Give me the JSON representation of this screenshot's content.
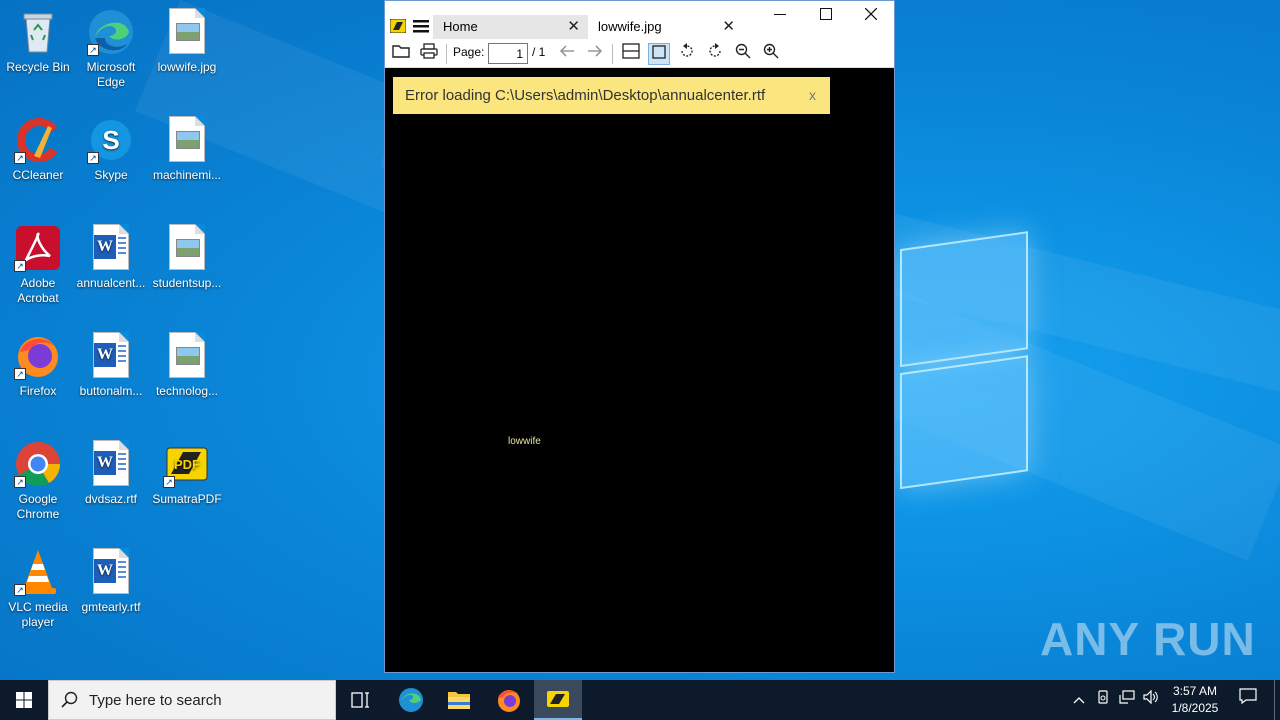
{
  "desktop": {
    "icons": [
      {
        "label": "Recycle Bin",
        "icon": "recycle-bin-icon"
      },
      {
        "label": "Microsoft Edge",
        "icon": "edge-icon"
      },
      {
        "label": "lowwife.jpg",
        "icon": "image-file-icon"
      },
      {
        "label": "CCleaner",
        "icon": "ccleaner-icon"
      },
      {
        "label": "Skype",
        "icon": "skype-icon"
      },
      {
        "label": "machinemi...",
        "icon": "image-file-icon"
      },
      {
        "label": "Adobe Acrobat",
        "icon": "acrobat-icon"
      },
      {
        "label": "annualcent...",
        "icon": "word-file-icon"
      },
      {
        "label": "studentsup...",
        "icon": "image-file-icon"
      },
      {
        "label": "Firefox",
        "icon": "firefox-icon"
      },
      {
        "label": "buttonalm...",
        "icon": "word-file-icon"
      },
      {
        "label": "technolog...",
        "icon": "image-file-icon"
      },
      {
        "label": "Google Chrome",
        "icon": "chrome-icon"
      },
      {
        "label": "dvdsaz.rtf",
        "icon": "word-file-icon"
      },
      {
        "label": "SumatraPDF",
        "icon": "sumatrapdf-icon"
      },
      {
        "label": "VLC media player",
        "icon": "vlc-icon"
      },
      {
        "label": "gmtearly.rtf",
        "icon": "word-file-icon"
      }
    ]
  },
  "viewer": {
    "tabs": [
      {
        "label": "Home"
      },
      {
        "label": "lowwife.jpg"
      }
    ],
    "toolbar": {
      "page_label": "Page:",
      "page_value": "1",
      "page_total": "/ 1"
    },
    "error_message": "Error loading C:\\Users\\admin\\Desktop\\annualcenter.rtf",
    "error_close": "x",
    "document_text": "lowwife"
  },
  "watermark": "ANY RUN",
  "taskbar": {
    "search_placeholder": "Type here to search",
    "clock_time": "3:57 AM",
    "clock_date": "1/8/2025"
  },
  "colors": {
    "error_bg": "#fbe57e",
    "taskbar_bg": "#0c1a2b",
    "desktop_bg": "#0a8ad8"
  }
}
